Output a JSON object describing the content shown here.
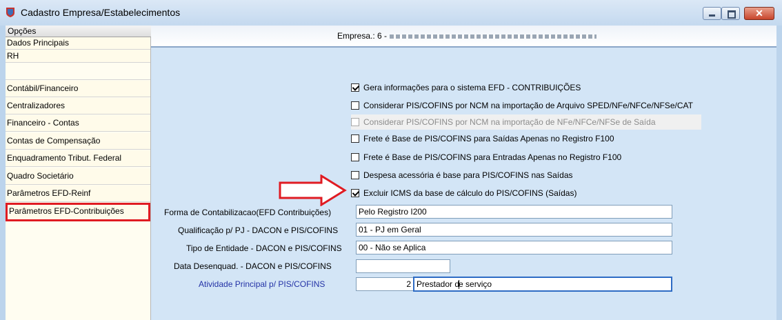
{
  "window": {
    "title": "Cadastro Empresa/Estabelecimentos"
  },
  "sidebar": {
    "header": "Opções",
    "items": [
      "Dados Principais",
      "RH",
      "Contábil/Financeiro",
      "Centralizadores",
      "Financeiro - Contas",
      "Contas de Compensação",
      "Enquadramento Tribut. Federal",
      "Quadro Societário",
      "Parâmetros EFD-Reinf",
      "Parâmetros EFD-Contribuições"
    ]
  },
  "header": {
    "empresa_label": "Empresa.: 6 -"
  },
  "checkboxes": [
    {
      "label": "Gera informações para o sistema EFD - CONTRIBUIÇÕES",
      "checked": true
    },
    {
      "label": "Considerar PIS/COFINS por NCM na importação de Arquivo SPED/NFe/NFCe/NFSe/CAT",
      "checked": false
    },
    {
      "label": "Considerar PIS/COFINS por NCM na importação de NFe/NFCe/NFSe de Saída",
      "checked": false,
      "disabled": true
    },
    {
      "label": "Frete é Base de PIS/COFINS para Saídas Apenas no Registro F100",
      "checked": false
    },
    {
      "label": "Frete é Base de PIS/COFINS para Entradas Apenas no Registro F100",
      "checked": false
    },
    {
      "label": "Despesa acessória é base para PIS/COFINS nas Saídas",
      "checked": false
    },
    {
      "label": "Excluir ICMS da base de cálculo do PIS/COFINS (Saídas)",
      "checked": true
    }
  ],
  "fields": {
    "forma": {
      "label": "Forma de Contabilizacao(EFD Contribuições)",
      "value": "Pelo Registro I200"
    },
    "qualificacao": {
      "label": "Qualificação p/ PJ - DACON e PIS/COFINS",
      "value": "01 - PJ em Geral"
    },
    "tipo": {
      "label": "Tipo de Entidade - DACON e PIS/COFINS",
      "value": "00 - Não se Aplica"
    },
    "data": {
      "label": "Data Desenquad. - DACON e PIS/COFINS",
      "value": ""
    },
    "atividade": {
      "label": "Atividade Principal p/ PIS/COFINS",
      "code": "2",
      "value_before_caret": "Prestador d",
      "value_after_caret": "e serviço"
    }
  },
  "colors": {
    "highlight_red": "#e01b22",
    "label_blue": "#2332a6",
    "panel_bg": "#d3e5f6"
  }
}
